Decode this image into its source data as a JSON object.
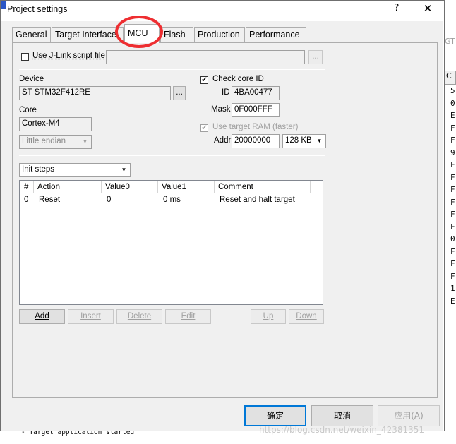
{
  "window": {
    "title": "Project settings",
    "help_glyph": "?",
    "close_glyph": "✕"
  },
  "tabs": [
    {
      "label": "General"
    },
    {
      "label": "Target Interface"
    },
    {
      "label": "MCU",
      "active": true
    },
    {
      "label": "Flash"
    },
    {
      "label": "Production"
    },
    {
      "label": "Performance"
    }
  ],
  "annotation_color": "#ee2e31",
  "script": {
    "checkbox_label": "Use J-Link script file",
    "checked": false,
    "path_value": "",
    "browse_label": "..."
  },
  "device": {
    "label": "Device",
    "value": "ST STM32F412RE",
    "browse_label": "..."
  },
  "core": {
    "label": "Core",
    "value": "Cortex-M4",
    "endian_value": "Little endian"
  },
  "check_core": {
    "label": "Check core ID",
    "checked": true,
    "id_label": "ID",
    "id_value": "4BA00477",
    "mask_label": "Mask",
    "mask_value": "0F000FFF"
  },
  "target_ram": {
    "label": "Use target RAM (faster)",
    "checked": true,
    "addr_label": "Addr",
    "addr_value": "20000000",
    "size_value": "128 KB"
  },
  "steps": {
    "dropdown_value": "Init steps",
    "columns": [
      "#",
      "Action",
      "Value0",
      "Value1",
      "Comment"
    ],
    "rows": [
      [
        "0",
        "Reset",
        "0",
        "0 ms",
        "Reset and halt target"
      ]
    ],
    "buttons": {
      "add": "Add",
      "insert": "Insert",
      "delete": "Delete",
      "edit": "Edit",
      "up": "Up",
      "down": "Down"
    }
  },
  "footer": {
    "ok": "确定",
    "cancel": "取消",
    "apply": "应用(A)",
    "watermark": "https://blog.csdn.net/weixin_42381351"
  },
  "background": {
    "right_tab": "C",
    "right_gt": "GT",
    "right_chars": [
      "5",
      "0",
      "E",
      "F",
      "F",
      "9",
      "F",
      "F",
      "F",
      "F",
      "F",
      "F",
      "0",
      "F",
      "F",
      "F",
      "1",
      "E"
    ],
    "log_line": "- Target application started"
  }
}
